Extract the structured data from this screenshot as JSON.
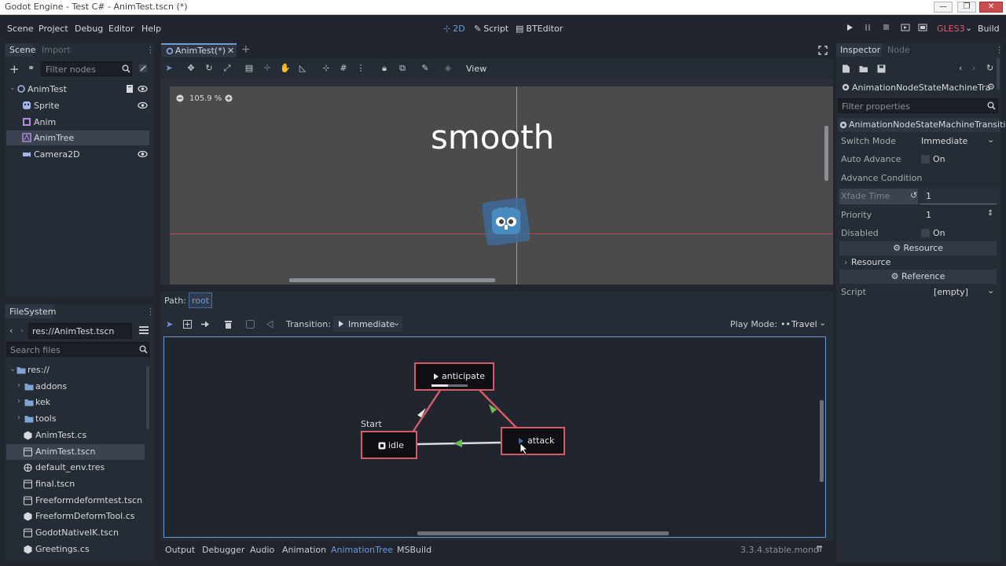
{
  "window": {
    "title": "Godot Engine - Test C# - AnimTest.tscn (*)",
    "minimize": "—",
    "maximize": "❐",
    "close": "✕"
  },
  "menu": {
    "items": [
      "Scene",
      "Project",
      "Debug",
      "Editor",
      "Help"
    ]
  },
  "workspaces": {
    "w2d": "2D",
    "script": "Script",
    "bteditor": "BTEditor"
  },
  "run_controls": {
    "renderer": "GLES3",
    "build": "Build"
  },
  "scene_dock": {
    "tabs": [
      "Scene",
      "Import"
    ],
    "filter_placeholder": "Filter nodes",
    "tree": [
      {
        "label": "AnimTest",
        "icon": "node2d-icon",
        "depth": 0,
        "selected": false
      },
      {
        "label": "Sprite",
        "icon": "sprite-icon",
        "depth": 1,
        "selected": false
      },
      {
        "label": "Anim",
        "icon": "animation-player-icon",
        "depth": 1,
        "selected": false
      },
      {
        "label": "AnimTree",
        "icon": "animation-tree-icon",
        "depth": 1,
        "selected": true
      },
      {
        "label": "Camera2D",
        "icon": "camera-icon",
        "depth": 1,
        "selected": false
      }
    ]
  },
  "filesystem_dock": {
    "title": "FileSystem",
    "path": "res://AnimTest.tscn",
    "search_placeholder": "Search files",
    "items": [
      {
        "label": "res://",
        "type": "folder",
        "depth": 0,
        "selected": false
      },
      {
        "label": "addons",
        "type": "folder",
        "depth": 1,
        "selected": false
      },
      {
        "label": "kek",
        "type": "folder",
        "depth": 1,
        "selected": false
      },
      {
        "label": "tools",
        "type": "folder",
        "depth": 1,
        "selected": false
      },
      {
        "label": "AnimTest.cs",
        "type": "script",
        "depth": 1,
        "selected": false
      },
      {
        "label": "AnimTest.tscn",
        "type": "scene",
        "depth": 1,
        "selected": true
      },
      {
        "label": "default_env.tres",
        "type": "resource",
        "depth": 1,
        "selected": false
      },
      {
        "label": "final.tscn",
        "type": "scene",
        "depth": 1,
        "selected": false
      },
      {
        "label": "Freeformdeformtest.tscn",
        "type": "scene",
        "depth": 1,
        "selected": false
      },
      {
        "label": "FreeformDeformTool.cs",
        "type": "script",
        "depth": 1,
        "selected": false
      },
      {
        "label": "GodotNativeIK.tscn",
        "type": "scene",
        "depth": 1,
        "selected": false
      },
      {
        "label": "Greetings.cs",
        "type": "script",
        "depth": 1,
        "selected": false
      }
    ]
  },
  "editor": {
    "tab": "AnimTest(*)",
    "view_menu": "View",
    "zoom": "105.9 %",
    "overlay_text": "smooth"
  },
  "animation_tree": {
    "path_label": "Path:",
    "path_value": "root",
    "transition_label": "Transition:",
    "transition_value": "Immediate",
    "play_mode_label": "Play Mode:",
    "play_mode_value": "Travel",
    "start_label": "Start",
    "nodes": {
      "anticipate": "anticipate",
      "idle": "idle",
      "attack": "attack"
    }
  },
  "bottom_tabs": {
    "items": [
      "Output",
      "Debugger",
      "Audio",
      "Animation",
      "AnimationTree",
      "MSBuild"
    ],
    "active": "AnimationTree",
    "version": "3.3.4.stable.mono"
  },
  "inspector": {
    "tabs": [
      "Inspector",
      "Node"
    ],
    "resource_header": "AnimationNodeStateMachineTra",
    "filter_placeholder": "Filter properties",
    "class_header": "AnimationNodeStateMachineTransition",
    "properties": {
      "switch_mode": {
        "label": "Switch Mode",
        "value": "Immediate"
      },
      "auto_advance": {
        "label": "Auto Advance",
        "value": "On"
      },
      "advance_condition": {
        "label": "Advance Condition",
        "value": ""
      },
      "xfade_time": {
        "label": "Xfade Time",
        "value": "1"
      },
      "priority": {
        "label": "Priority",
        "value": "1"
      },
      "disabled": {
        "label": "Disabled",
        "value": "On"
      }
    },
    "resource_section": "Resource",
    "resource_sub": "Resource",
    "reference_section": "Reference",
    "script": {
      "label": "Script",
      "value": "[empty]"
    }
  },
  "colors": {
    "accent": "#6c9bd8",
    "node_border": "#d45c66",
    "connection": "#d45c66",
    "arrow_green": "#6bbf4e",
    "renderer": "#e05a72"
  }
}
